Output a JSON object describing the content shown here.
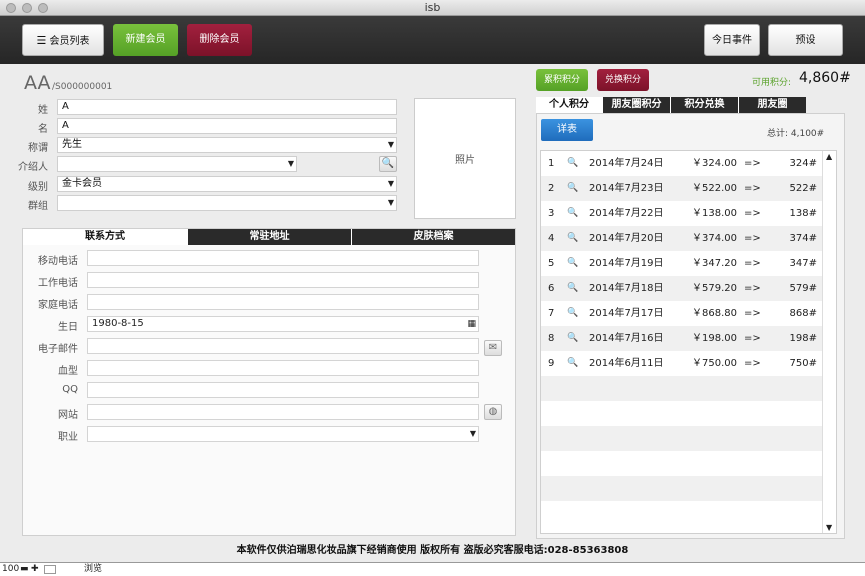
{
  "window": {
    "title": "isb"
  },
  "toolbar": {
    "member_list": "会员列表",
    "new_member": "新建会员",
    "delete_member": "删除会员",
    "today_events": "今日事件",
    "presets": "预设"
  },
  "header": {
    "initials": "AA",
    "member_id": "/S000000001"
  },
  "form": {
    "surname_label": "姓",
    "surname": "A",
    "given_label": "名",
    "given": "A",
    "title_label": "称谓",
    "title": "先生",
    "referrer_label": "介绍人",
    "referrer": "",
    "level_label": "级别",
    "level": "金卡会员",
    "group_label": "群组",
    "group": "",
    "photo": "照片"
  },
  "contact_tabs": [
    "联系方式",
    "常驻地址",
    "皮肤档案"
  ],
  "contact": {
    "mobile_label": "移动电话",
    "mobile": "",
    "work_label": "工作电话",
    "work": "",
    "home_label": "家庭电话",
    "home": "",
    "birthday_label": "生日",
    "birthday": "1980-8-15",
    "email_label": "电子邮件",
    "email": "",
    "blood_label": "血型",
    "blood": "",
    "qq_label": "QQ",
    "qq": "",
    "website_label": "网站",
    "website": "",
    "job_label": "职业",
    "job": ""
  },
  "points": {
    "accumulate_btn": "累积积分",
    "redeem_btn": "兑换积分",
    "available_label": "可用积分:",
    "available_value": "4,860#",
    "tabs": [
      "个人积分",
      "朋友圈积分",
      "积分兑换",
      "朋友圈"
    ],
    "detail_btn": "详表",
    "total_label": "总计: 4,100#",
    "rows": [
      {
        "n": "1",
        "date": "2014年7月24日",
        "amount": "￥324.00",
        "arrow": "=>",
        "pts": "324#"
      },
      {
        "n": "2",
        "date": "2014年7月23日",
        "amount": "￥522.00",
        "arrow": "=>",
        "pts": "522#"
      },
      {
        "n": "3",
        "date": "2014年7月22日",
        "amount": "￥138.00",
        "arrow": "=>",
        "pts": "138#"
      },
      {
        "n": "4",
        "date": "2014年7月20日",
        "amount": "￥374.00",
        "arrow": "=>",
        "pts": "374#"
      },
      {
        "n": "5",
        "date": "2014年7月19日",
        "amount": "￥347.20",
        "arrow": "=>",
        "pts": "347#"
      },
      {
        "n": "6",
        "date": "2014年7月18日",
        "amount": "￥579.20",
        "arrow": "=>",
        "pts": "579#"
      },
      {
        "n": "7",
        "date": "2014年7月17日",
        "amount": "￥868.80",
        "arrow": "=>",
        "pts": "868#"
      },
      {
        "n": "8",
        "date": "2014年7月16日",
        "amount": "￥198.00",
        "arrow": "=>",
        "pts": "198#"
      },
      {
        "n": "9",
        "date": "2014年6月11日",
        "amount": "￥750.00",
        "arrow": "=>",
        "pts": "750#"
      }
    ]
  },
  "footer": {
    "notice": "本软件仅供泊瑞思化妆品旗下经销商使用 版权所有 盗版必究客服电话:028-85363808"
  },
  "status": {
    "zoom": "100",
    "mode": "浏览"
  },
  "colors": {
    "accent_green": "#6ab433",
    "accent_red": "#8e1a33",
    "detail_blue": "#2a7fd0",
    "available_green": "#5aa22b"
  }
}
